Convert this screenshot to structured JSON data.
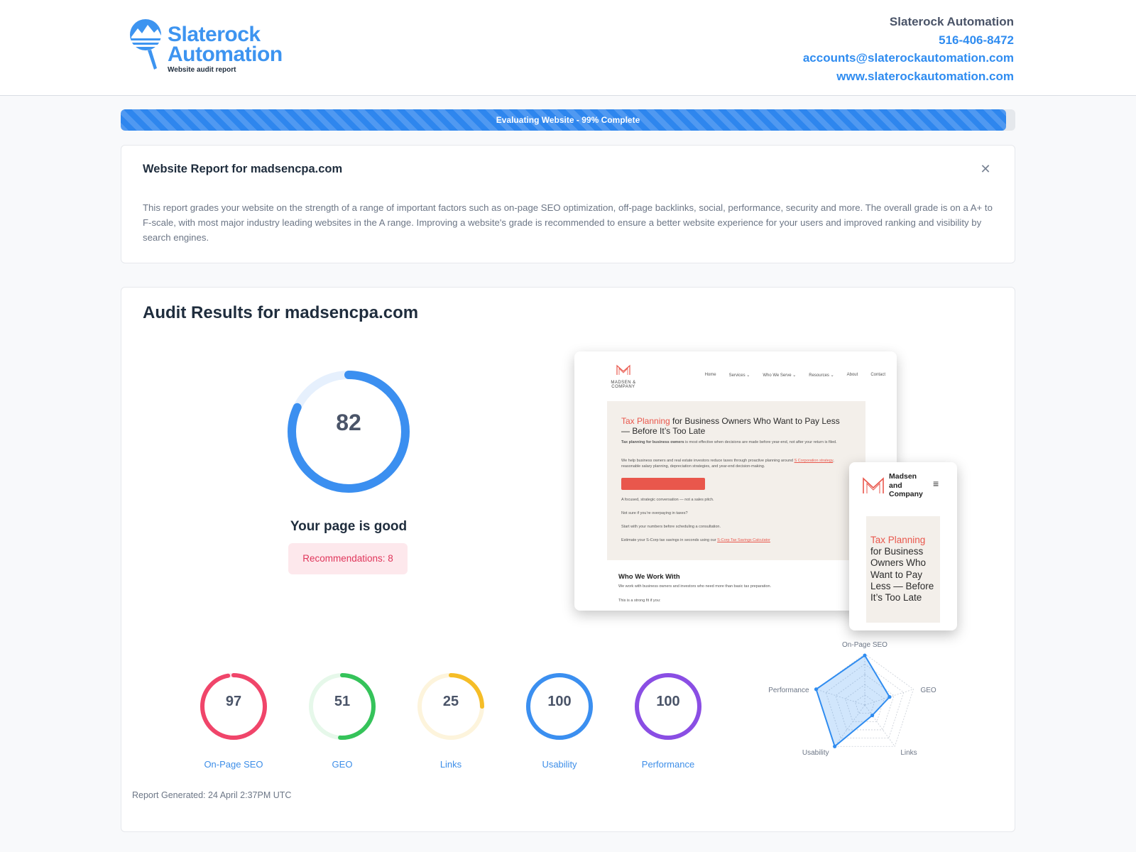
{
  "header": {
    "brand_line1": "Slaterock",
    "brand_line2": "Automation",
    "tagline": "Website audit report",
    "company": "Slaterock Automation",
    "phone": "516-406-8472",
    "email": "accounts@slaterockautomation.com",
    "website": "www.slaterockautomation.com"
  },
  "progress": {
    "label": "Evaluating Website - 99% Complete",
    "percent": 99
  },
  "report_card": {
    "title": "Website Report for madsencpa.com",
    "close_icon": "close-icon",
    "description": "This report grades your website on the strength of a range of important factors such as on-page SEO optimization, off-page backlinks, social, performance, security and more. The overall grade is on a A+ to F-scale, with most major industry leading websites in the A range. Improving a website's grade is recommended to ensure a better website experience for your users and improved ranking and visibility by search engines."
  },
  "audit": {
    "title": "Audit Results for madsencpa.com",
    "score": 82,
    "verdict": "Your page is good",
    "recommendations": "Recommendations: 8",
    "generated": "Report Generated: 24 April 2:37PM UTC"
  },
  "preview": {
    "desktop": {
      "logo_name": "MADSEN & COMPANY",
      "nav": [
        "Home",
        "Services ⌄",
        "Who We Serve ⌄",
        "Resources ⌄",
        "About",
        "Contact"
      ],
      "hero_accent": "Tax Planning",
      "hero_rest": " for Business Owners Who Want to Pay Less — Before It’s Too Late",
      "p1_bold": "Tax planning for business owners",
      "p1_rest": " is most effective when decisions are made before year-end, not after your return is filed.",
      "p2_before": "We help business owners and real estate investors reduce taxes through proactive planning around ",
      "p2_link": "S Corporation strategy",
      "p2_after": ", reasonable salary planning, depreciation strategies, and year-end decision-making.",
      "line1": "A focused, strategic conversation — not a sales pitch.",
      "line2": "Not sure if you’re overpaying in taxes?",
      "line3": "Start with your numbers before scheduling a consultation.",
      "line4_before": "Estimate your S-Corp tax savings in seconds using our ",
      "line4_link": "S-Corp Tax Savings Calculator",
      "section_title": "Who We Work With",
      "section_text": "We work with business owners and investors who need more than basic tax preparation.",
      "section_text2": "This is a strong fit if you:"
    },
    "mobile": {
      "name_line1": "Madsen",
      "name_line2": "and",
      "name_line3": "Company",
      "menu_icon": "hamburger-menu-icon",
      "hero_accent": "Tax Planning",
      "hero_rest": " for Business Owners Who Want to Pay Less — Before It’s Too Late"
    }
  },
  "scores": [
    {
      "label": "On-Page SEO",
      "value": 97,
      "color": "#f0456a",
      "track": "#fde4ea"
    },
    {
      "label": "GEO",
      "value": 51,
      "color": "#35c35a",
      "track": "#e6f8ea"
    },
    {
      "label": "Links",
      "value": 25,
      "color": "#f5bd27",
      "track": "#fdf4dc"
    },
    {
      "label": "Usability",
      "value": 100,
      "color": "#3b8ff0",
      "track": "#e3effd"
    },
    {
      "label": "Performance",
      "value": 100,
      "color": "#8a4ee4",
      "track": "#efe6fb"
    }
  ],
  "radar": {
    "axes": [
      "On-Page SEO",
      "GEO",
      "Links",
      "Usability",
      "Performance"
    ],
    "values": [
      97,
      51,
      25,
      100,
      100
    ],
    "max": 100,
    "color": "#2f8cf0"
  },
  "colors": {
    "brand": "#3d94f0",
    "main_gauge": "#3b8ff0",
    "main_track": "#e6f0fd"
  }
}
